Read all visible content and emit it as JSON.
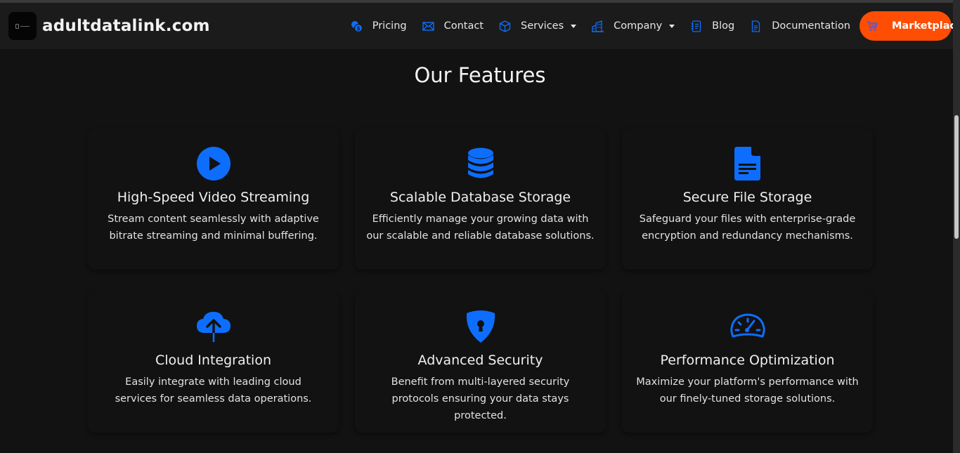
{
  "brand": {
    "name": "adultdatalink.com",
    "logo_icon": "database-logo-icon"
  },
  "nav": {
    "items": [
      {
        "label": "Pricing",
        "icon": "coins-icon",
        "dropdown": false
      },
      {
        "label": "Contact",
        "icon": "envelope-icon",
        "dropdown": false
      },
      {
        "label": "Services",
        "icon": "box-icon",
        "dropdown": true
      },
      {
        "label": "Company",
        "icon": "building-icon",
        "dropdown": true
      },
      {
        "label": "Blog",
        "icon": "journal-text-icon",
        "dropdown": false
      },
      {
        "label": "Documentation",
        "icon": "file-text-icon",
        "dropdown": false
      }
    ],
    "cta": {
      "label": "Marketplace",
      "icon": "cart-icon",
      "color": "#ff4d04"
    }
  },
  "colors": {
    "accent": "#0d6efd",
    "background": "#121212",
    "navbar": "#1b1b1b"
  },
  "features": {
    "title": "Our Features",
    "items": [
      {
        "title": "High-Speed Video Streaming",
        "description": "Stream content seamlessly with adaptive bitrate streaming and minimal buffering.",
        "icon": "play-circle-icon"
      },
      {
        "title": "Scalable Database Storage",
        "description": "Efficiently manage your growing data with our scalable and reliable database solutions.",
        "icon": "database-icon"
      },
      {
        "title": "Secure File Storage",
        "description": "Safeguard your files with enterprise-grade encryption and redundancy mechanisms.",
        "icon": "file-earmark-text-icon"
      },
      {
        "title": "Cloud Integration",
        "description": "Easily integrate with leading cloud services for seamless data operations.",
        "icon": "cloud-upload-icon"
      },
      {
        "title": "Advanced Security",
        "description": "Benefit from multi-layered security protocols ensuring your data stays protected.",
        "icon": "shield-lock-icon"
      },
      {
        "title": "Performance Optimization",
        "description": "Maximize your platform's performance with our finely-tuned storage solutions.",
        "icon": "speedometer-icon"
      }
    ]
  }
}
